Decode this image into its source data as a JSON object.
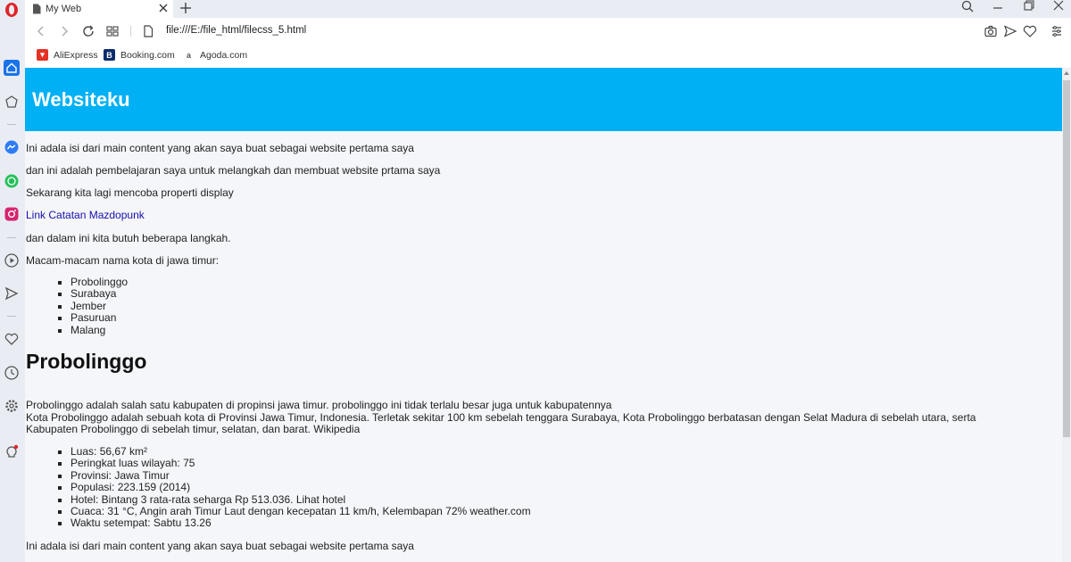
{
  "browser": {
    "tab_title": "My Web",
    "url": "file:///E:/file_html/filecss_5.html",
    "bookmarks": [
      {
        "label": "AliExpress",
        "color": "#e43225"
      },
      {
        "label": "Booking.com",
        "color": "#0b2d6b"
      },
      {
        "label": "Agoda.com",
        "color": "#666666"
      }
    ]
  },
  "site": {
    "title": "Websiteku",
    "paragraphs": [
      "Ini adala isi dari main content yang akan saya buat sebagai website pertama saya",
      "dan ini adalah pembelajaran saya untuk melangkah dan membuat website prtama saya",
      "Sekarang kita lagi mencoba properti display"
    ],
    "link_text": "Link Catatan Mazdopunk",
    "para_steps": "dan dalam ini kita butuh beberapa langkah.",
    "cities_intro": "Macam-macam nama kota di jawa timur:",
    "cities": [
      "Probolinggo",
      "Surabaya",
      "Jember",
      "Pasuruan",
      "Malang"
    ],
    "heading": "Probolinggo",
    "desc_line1": "Probolinggo adalah salah satu kabupaten di propinsi jawa timur. probolinggo ini tidak terlalu besar juga untuk kabupatennya",
    "desc_line2": "Kota Probolinggo adalah sebuah kota di Provinsi Jawa Timur, Indonesia. Terletak sekitar 100 km sebelah tenggara Surabaya, Kota Probolinggo berbatasan dengan Selat Madura di sebelah utara, serta Kabupaten Probolinggo di sebelah timur, selatan, dan barat. Wikipedia",
    "facts": [
      "Luas: 56,67 km²",
      "Peringkat luas wilayah: 75",
      "Provinsi: Jawa Timur",
      "Populasi: 223.159 (2014)",
      "Hotel: Bintang 3 rata-rata seharga Rp 513.036. Lihat hotel",
      "Cuaca: 31 °C, Angin arah Timur Laut dengan kecepatan 11 km/h, Kelembapan 72% weather.com",
      "Waktu setempat: Sabtu 13.26"
    ],
    "footer_para": "Ini adala isi dari main content yang akan saya buat sebagai website pertama saya"
  },
  "colors": {
    "header_bg": "#00b0f4",
    "opera_red": "#e0242b",
    "sidebar_active": "#1a73e8"
  }
}
